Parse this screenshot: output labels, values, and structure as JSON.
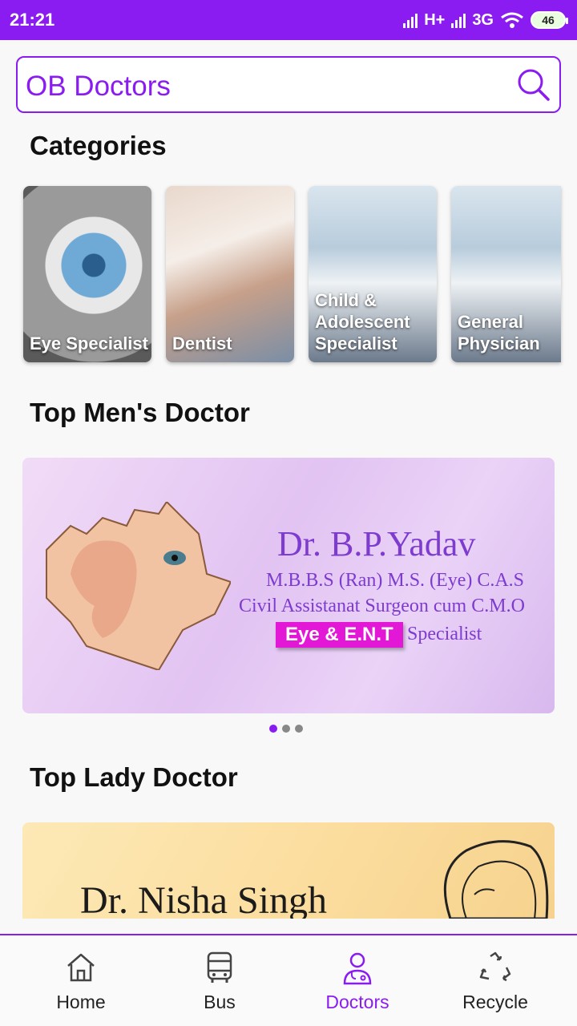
{
  "status_bar": {
    "time": "21:21",
    "network_1": "H+",
    "network_2": "3G",
    "battery": "46"
  },
  "search": {
    "value": "OB Doctors"
  },
  "sections": {
    "categories": "Categories",
    "top_men": "Top Men's Doctor",
    "top_lady": "Top Lady Doctor"
  },
  "categories": [
    {
      "label": "Eye Specialist"
    },
    {
      "label": "Dentist"
    },
    {
      "label": "Child & Adolescent Specialist"
    },
    {
      "label": "General Physician"
    }
  ],
  "men_banner": {
    "name": "Dr. B.P.Yadav",
    "qualification": "M.B.B.S (Ran) M.S. (Eye) C.A.S",
    "role": "Civil Assistanat Surgeon cum C.M.O",
    "tag": "Eye & E.N.T",
    "specialist": "Specialist",
    "page_count": 3,
    "active_page": 1
  },
  "lady_banner": {
    "name": "Dr. Nisha Singh"
  },
  "bottom_nav": {
    "items": [
      {
        "label": "Home",
        "icon": "home-icon"
      },
      {
        "label": "Bus",
        "icon": "bus-icon"
      },
      {
        "label": "Doctors",
        "icon": "doctor-icon",
        "active": true
      },
      {
        "label": "Recycle",
        "icon": "recycle-icon"
      }
    ]
  },
  "colors": {
    "accent": "#8a1cf2",
    "tag_magenta": "#e317d6"
  }
}
